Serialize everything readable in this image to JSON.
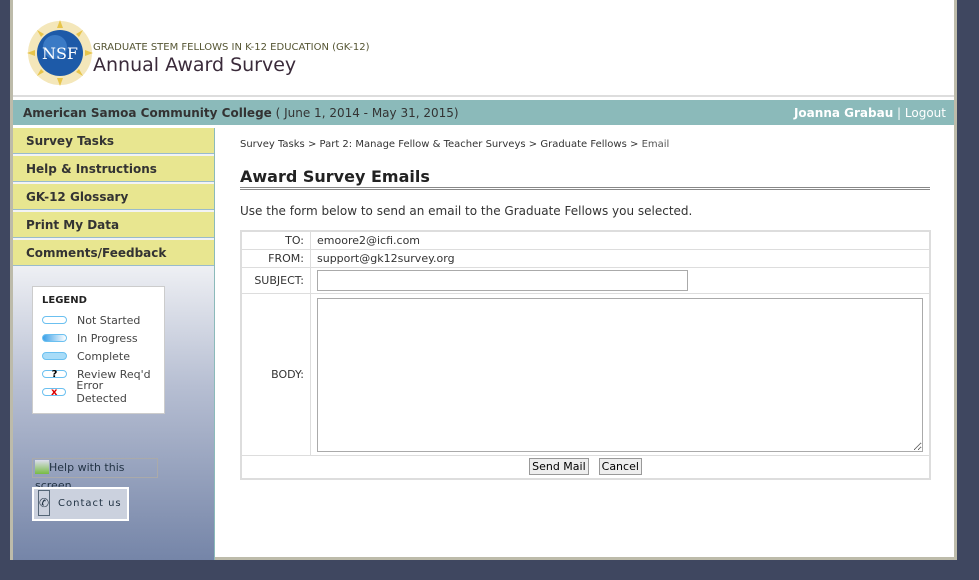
{
  "header": {
    "logo_text": "NSF",
    "subtitle": "GRADUATE STEM FELLOWS IN K-12 EDUCATION (GK-12)",
    "title": "Annual Award Survey"
  },
  "bar": {
    "institution": "American Samoa Community College",
    "period": " ( June 1, 2014 - May 31, 2015)",
    "user": "Joanna Grabau",
    "separator": " | ",
    "logout": "Logout"
  },
  "sidebar": {
    "items": [
      {
        "label": "Survey Tasks"
      },
      {
        "label": "Help & Instructions"
      },
      {
        "label": "GK-12 Glossary"
      },
      {
        "label": "Print My Data"
      },
      {
        "label": "Comments/Feedback"
      }
    ],
    "legend": {
      "title": "LEGEND",
      "items": [
        {
          "label": "Not Started"
        },
        {
          "label": "In Progress"
        },
        {
          "label": "Complete"
        },
        {
          "label": "Review Req'd",
          "mark": "?"
        },
        {
          "label": "Error Detected",
          "mark": "x"
        }
      ]
    },
    "help": "Help with this screen",
    "contact": "Contact us"
  },
  "breadcrumb": [
    {
      "label": "Survey Tasks"
    },
    {
      "label": "Part 2: Manage Fellow & Teacher Surveys"
    },
    {
      "label": "Graduate Fellows"
    },
    {
      "label": "Email"
    }
  ],
  "breadcrumb_sep": " > ",
  "page_title": "Award Survey Emails",
  "intro": "Use the form below to send an email to the Graduate Fellows you selected.",
  "form": {
    "to_label": "TO:",
    "to": "emoore2@icfi.com",
    "from_label": "FROM:",
    "from": "support@gk12survey.org",
    "subject_label": "SUBJECT:",
    "subject": "",
    "body_label": "BODY:",
    "body": "",
    "send": "Send Mail",
    "cancel": "Cancel"
  }
}
